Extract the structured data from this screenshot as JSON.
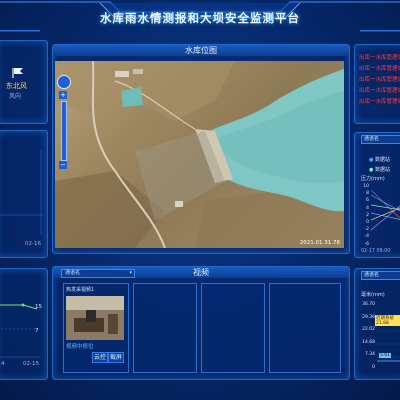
{
  "header": {
    "title": "水库雨水情测报和大坝安全监测平台"
  },
  "weather": {
    "wind_dir": "东北风",
    "wind_label": "风向"
  },
  "map_panel": {
    "title": "水库位图",
    "timestamp": "2021.01.31.76"
  },
  "left_mid": {
    "xticks": [
      "02-16"
    ]
  },
  "left_bottom": {
    "values": [
      "15",
      "7"
    ],
    "xticks": [
      "4",
      "02-15"
    ]
  },
  "video_panel": {
    "title": "视频",
    "select": "通道名",
    "cam_label": "热发采视频1",
    "cam_caption": "视频中修位",
    "buttons": [
      "云控",
      "截屏"
    ]
  },
  "right_top": {
    "alerts": [
      "出库一水库管理站监测",
      "出库一水库管理站监测",
      "出库一水库管理站监测",
      "出库一水库管理站监测",
      "出库一水库管理站监测"
    ]
  },
  "right_mid": {
    "select": "通道名",
    "legend": [
      "数据站",
      "数据站"
    ],
    "ylabel": "压力(mm)",
    "yticks": [
      "10",
      "8",
      "6",
      "4",
      "2",
      "0",
      "-2",
      "-4",
      "-6"
    ],
    "xtick": "02-17 09:00"
  },
  "right_bottom": {
    "select": "通道名",
    "ylabel": "毫米(mm)",
    "yticks": [
      "36.70",
      "29.36",
      "22.02",
      "14.68",
      "7.34",
      "0"
    ],
    "callout1": "近期系统21.88",
    "callout2": "5.01"
  }
}
